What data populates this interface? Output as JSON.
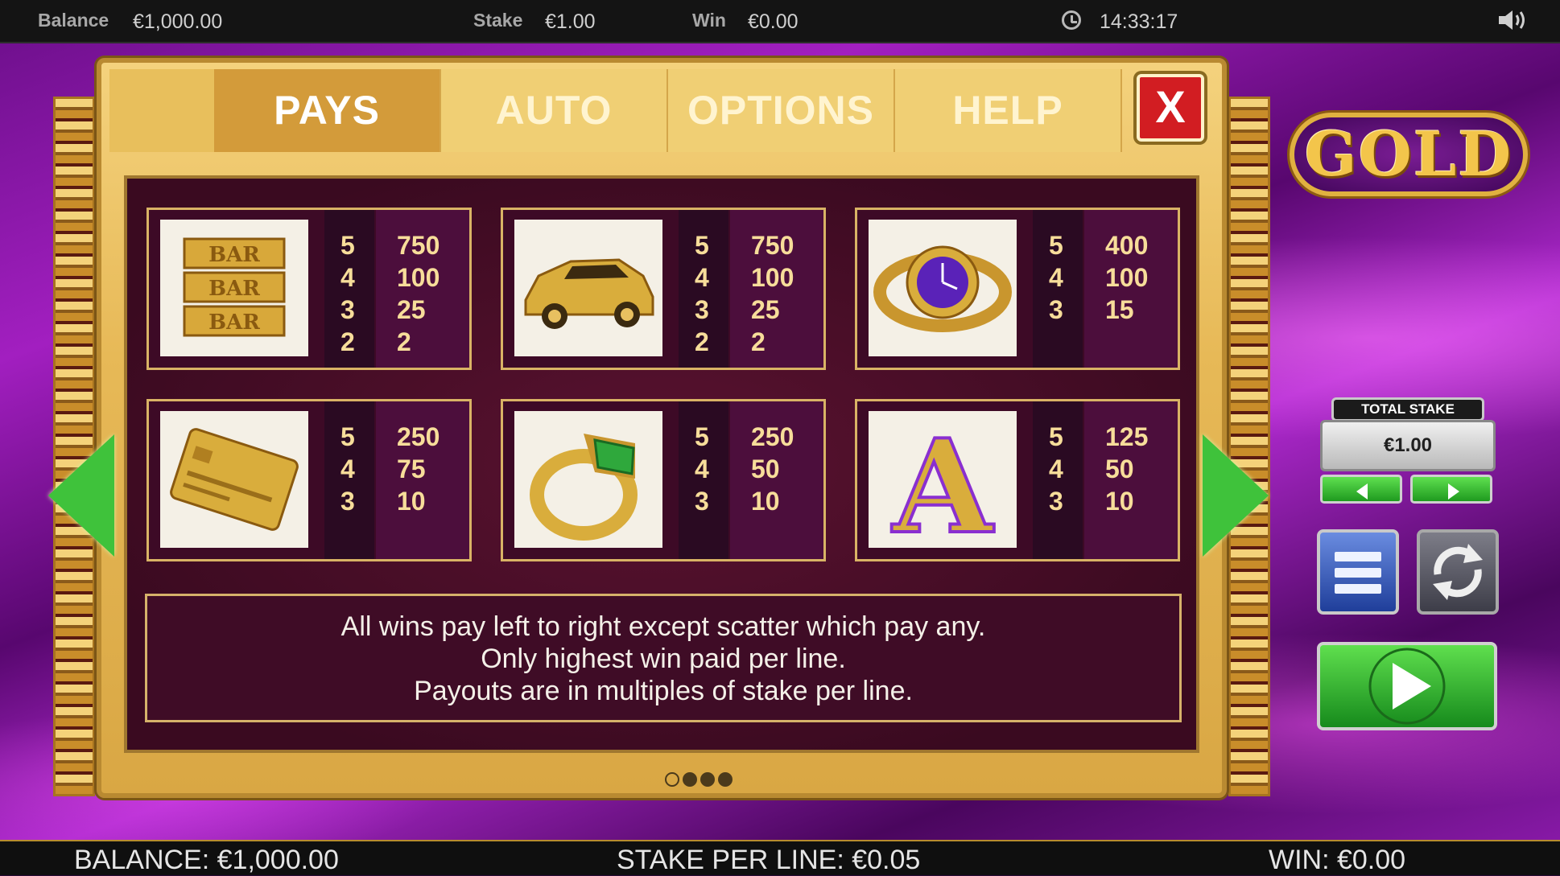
{
  "topbar": {
    "balance_label": "Balance",
    "balance_value": "€1,000.00",
    "stake_label": "Stake",
    "stake_value": "€1.00",
    "win_label": "Win",
    "win_value": "€0.00",
    "time": "14:33:17"
  },
  "tabs": [
    "PAYS",
    "AUTO",
    "OPTIONS",
    "HELP"
  ],
  "active_tab": "PAYS",
  "close_label": "X",
  "paytable": [
    {
      "symbol": "gold-bars",
      "counts": [
        "5",
        "4",
        "3",
        "2"
      ],
      "pays": [
        "750",
        "100",
        "25",
        "2"
      ]
    },
    {
      "symbol": "gold-car",
      "counts": [
        "5",
        "4",
        "3",
        "2"
      ],
      "pays": [
        "750",
        "100",
        "25",
        "2"
      ]
    },
    {
      "symbol": "gold-watch",
      "counts": [
        "5",
        "4",
        "3"
      ],
      "pays": [
        "400",
        "100",
        "15"
      ]
    },
    {
      "symbol": "gold-card",
      "counts": [
        "5",
        "4",
        "3"
      ],
      "pays": [
        "250",
        "75",
        "10"
      ]
    },
    {
      "symbol": "emerald-ring",
      "counts": [
        "5",
        "4",
        "3"
      ],
      "pays": [
        "250",
        "50",
        "10"
      ]
    },
    {
      "symbol": "letter-a",
      "counts": [
        "5",
        "4",
        "3"
      ],
      "pays": [
        "125",
        "50",
        "10"
      ]
    }
  ],
  "bar_label": "BAR",
  "letter_label": "A",
  "note": {
    "line1": "All wins pay left to right except scatter which pay any.",
    "line2": "Only highest win paid per line.",
    "line3": "Payouts are in multiples of stake per line."
  },
  "pagination": {
    "page": 1,
    "total": 4
  },
  "logo_text": "GOLD",
  "stake_widget": {
    "title": "TOTAL STAKE",
    "value": "€1.00"
  },
  "bottombar": {
    "balance": "BALANCE: €1,000.00",
    "stake_per_line": "STAKE PER LINE: €0.05",
    "win": "WIN: €0.00"
  },
  "colors": {
    "accent_gold": "#e0b13f",
    "close_red": "#d21d22",
    "arrow_green": "#3fc23b"
  }
}
